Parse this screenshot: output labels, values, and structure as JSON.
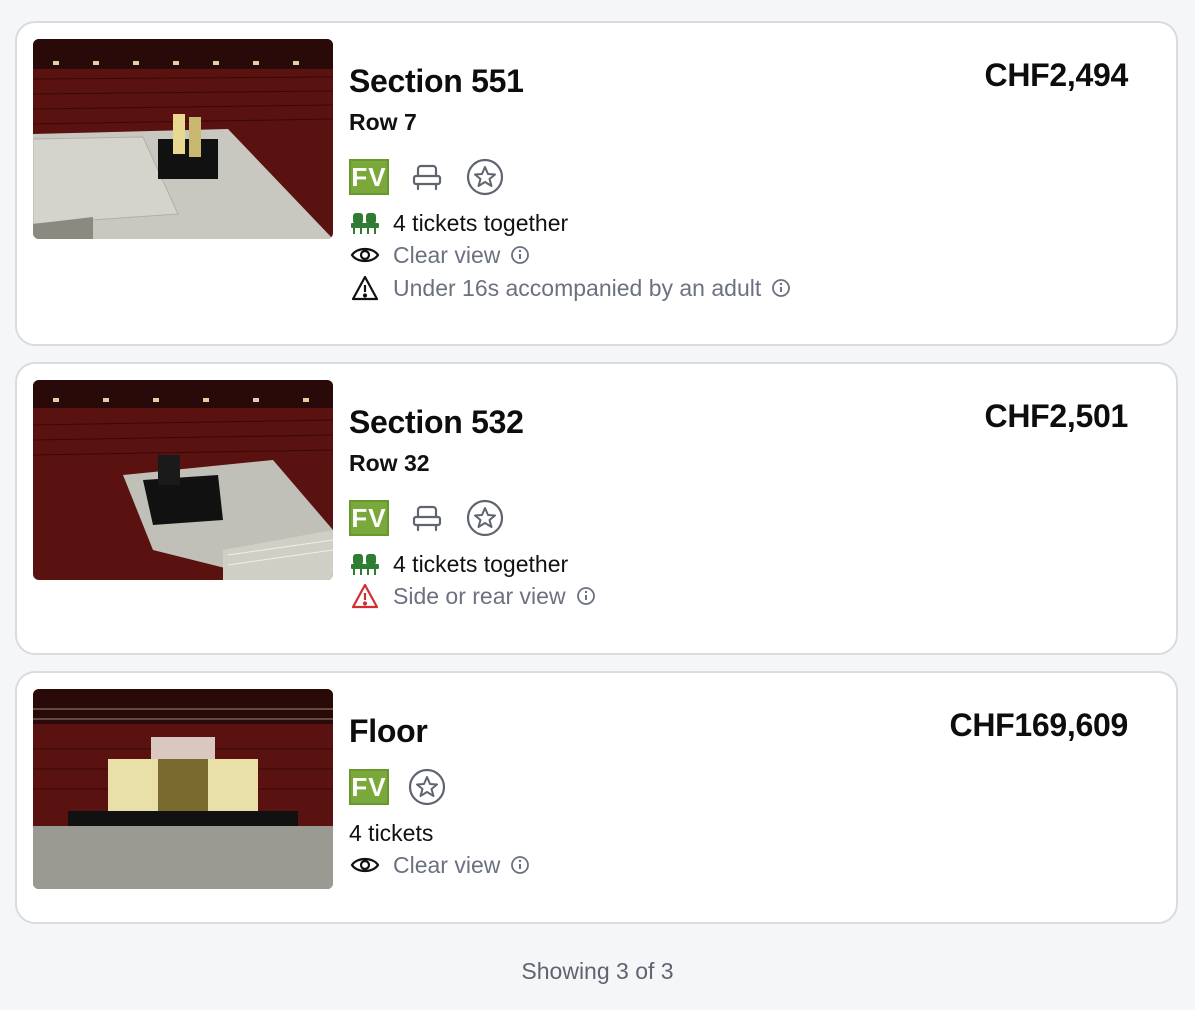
{
  "listings": [
    {
      "section": "Section 551",
      "row": "Row 7",
      "price": "CHF2,494",
      "badges": {
        "fv": "FV",
        "seat_icon": "armchair-icon",
        "star_icon": "star-icon"
      },
      "features": [
        {
          "icon": "seats-together-icon",
          "text": "4 tickets together"
        },
        {
          "icon": "eye-icon",
          "text": "Clear view",
          "info": true
        },
        {
          "icon": "warning-icon",
          "text": "Under 16s accompanied by an adult",
          "info": true
        }
      ]
    },
    {
      "section": "Section 532",
      "row": "Row 32",
      "price": "CHF2,501",
      "badges": {
        "fv": "FV",
        "seat_icon": "armchair-icon",
        "star_icon": "star-icon"
      },
      "features": [
        {
          "icon": "seats-together-icon",
          "text": "4 tickets together"
        },
        {
          "icon": "warning-red-icon",
          "text": "Side or rear view",
          "info": true
        }
      ]
    },
    {
      "section": "Floor",
      "price": "CHF169,609",
      "badges": {
        "fv": "FV",
        "star_icon": "star-icon"
      },
      "features": [
        {
          "text": "4 tickets"
        },
        {
          "icon": "eye-icon",
          "text": "Clear view",
          "info": true
        }
      ]
    }
  ],
  "footer": {
    "showing": "Showing 3 of 3"
  },
  "colors": {
    "fv_green": "#7aa83a",
    "seats_green": "#2e7d32",
    "warning_red": "#d32f2f",
    "muted_text": "#6b7180"
  }
}
